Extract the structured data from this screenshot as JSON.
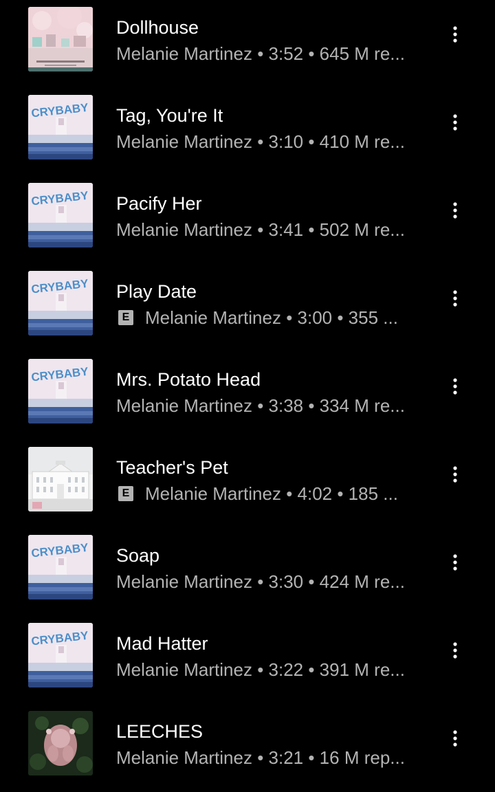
{
  "colors": {
    "background": "#000000",
    "title": "#ffffff",
    "subtitle": "#b3b3b3"
  },
  "explicit_badge": "E",
  "songs": [
    {
      "title": "Dollhouse",
      "meta": "Melanie Martinez • 3:52 • 645 M re...",
      "explicit": false,
      "art": "dollhouse-album-art"
    },
    {
      "title": "Tag, You're It",
      "meta": "Melanie Martinez • 3:10 • 410 M re...",
      "explicit": false,
      "art": "crybaby-album-art"
    },
    {
      "title": "Pacify Her",
      "meta": "Melanie Martinez • 3:41 • 502 M re...",
      "explicit": false,
      "art": "crybaby-album-art"
    },
    {
      "title": "Play Date",
      "meta": "Melanie Martinez • 3:00 • 355 ...",
      "explicit": true,
      "art": "crybaby-album-art"
    },
    {
      "title": "Mrs. Potato Head",
      "meta": "Melanie Martinez • 3:38 • 334 M re...",
      "explicit": false,
      "art": "crybaby-album-art"
    },
    {
      "title": "Teacher's Pet",
      "meta": "Melanie Martinez • 4:02 • 185 ...",
      "explicit": true,
      "art": "k12-album-art"
    },
    {
      "title": "Soap",
      "meta": "Melanie Martinez • 3:30 • 424 M re...",
      "explicit": false,
      "art": "crybaby-album-art"
    },
    {
      "title": "Mad Hatter",
      "meta": "Melanie Martinez • 3:22 • 391 M re...",
      "explicit": false,
      "art": "crybaby-album-art"
    },
    {
      "title": "LEECHES",
      "meta": "Melanie Martinez • 3:21 • 16 M rep...",
      "explicit": false,
      "art": "portals-album-art"
    }
  ]
}
